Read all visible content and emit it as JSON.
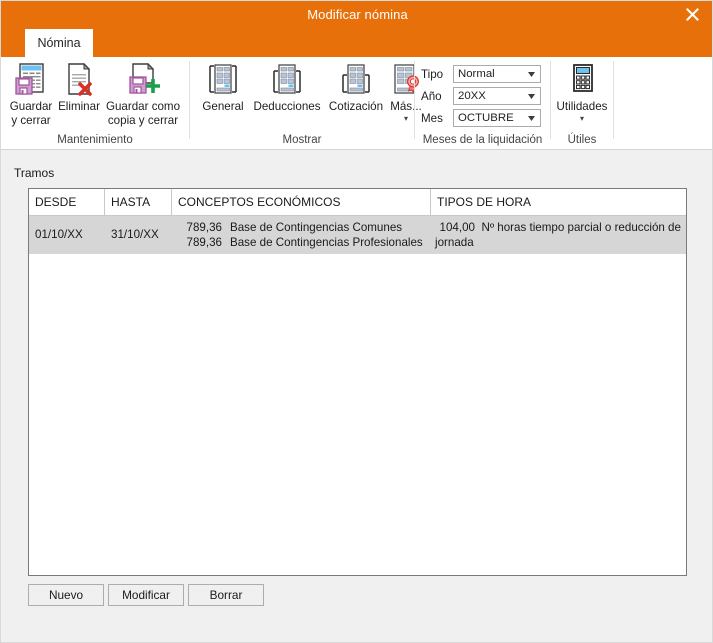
{
  "window": {
    "title": "Modificar nómina",
    "close_icon": "close-icon"
  },
  "ribbon": {
    "tab": {
      "label": "Nómina"
    },
    "groups": [
      {
        "name": "mantenimiento",
        "label": "Mantenimiento",
        "buttons": [
          {
            "name": "guardar-y-cerrar",
            "label": "Guardar\ny cerrar",
            "icon": "save-close-icon",
            "caret": ""
          },
          {
            "name": "eliminar",
            "label": "Eliminar",
            "icon": "delete-document-icon",
            "caret": ""
          },
          {
            "name": "guardar-como-copia-y-cerrar",
            "label": "Guardar como\ncopia y cerrar ",
            "icon": "save-copy-icon",
            "caret": "▾"
          }
        ]
      },
      {
        "name": "mostrar",
        "label": "Mostrar",
        "buttons": [
          {
            "name": "general",
            "label": "General",
            "icon": "form-general-icon",
            "caret": ""
          },
          {
            "name": "deducciones",
            "label": "Deducciones",
            "icon": "form-deductions-icon",
            "caret": ""
          },
          {
            "name": "cotizacion",
            "label": "Cotización",
            "icon": "form-contribution-icon",
            "caret": ""
          },
          {
            "name": "mas",
            "label": "Más...",
            "icon": "form-seal-icon",
            "caret": "▾"
          }
        ]
      },
      {
        "name": "meses-de-la-liquidacion",
        "label": "Meses de la liquidación",
        "fields": [
          {
            "name": "tipo",
            "label": "Tipo",
            "value": "Normal"
          },
          {
            "name": "ano",
            "label": "Año",
            "value": "20XX"
          },
          {
            "name": "mes",
            "label": "Mes",
            "value": "OCTUBRE"
          }
        ]
      },
      {
        "name": "utiles",
        "label": "Útiles",
        "buttons": [
          {
            "name": "utilidades",
            "label": "Utilidades",
            "icon": "calculator-icon",
            "caret": "▾"
          }
        ]
      }
    ]
  },
  "main": {
    "section_label": "Tramos",
    "grid": {
      "columns": [
        {
          "key": "desde",
          "label": "DESDE"
        },
        {
          "key": "hasta",
          "label": "HASTA"
        },
        {
          "key": "conceptos",
          "label": "CONCEPTOS ECONÓMICOS"
        },
        {
          "key": "tipos_hora",
          "label": "TIPOS DE HORA"
        }
      ],
      "rows": [
        {
          "desde": "01/10/XX",
          "hasta": "31/10/XX",
          "conceptos": [
            {
              "amount": "789,36",
              "description": "Base de Contingencias Comunes"
            },
            {
              "amount": "789,36",
              "description": "Base de Contingencias Profesionales"
            }
          ],
          "tipos_hora": [
            {
              "amount": "104,00",
              "description": "Nº horas tiempo parcial o reducción de jornada"
            }
          ],
          "selected": true
        }
      ]
    },
    "buttons": [
      {
        "name": "nuevo",
        "label": "Nuevo"
      },
      {
        "name": "modificar",
        "label": "Modificar"
      },
      {
        "name": "borrar",
        "label": "Borrar"
      }
    ]
  },
  "colors": {
    "title_bar": "#e8700a",
    "row_selected": "#d6d6d6",
    "grid_border": "#7a7a7a",
    "accent_save": "#b86fb8",
    "accent_delete": "#d93025",
    "accent_add": "#18a04a"
  }
}
